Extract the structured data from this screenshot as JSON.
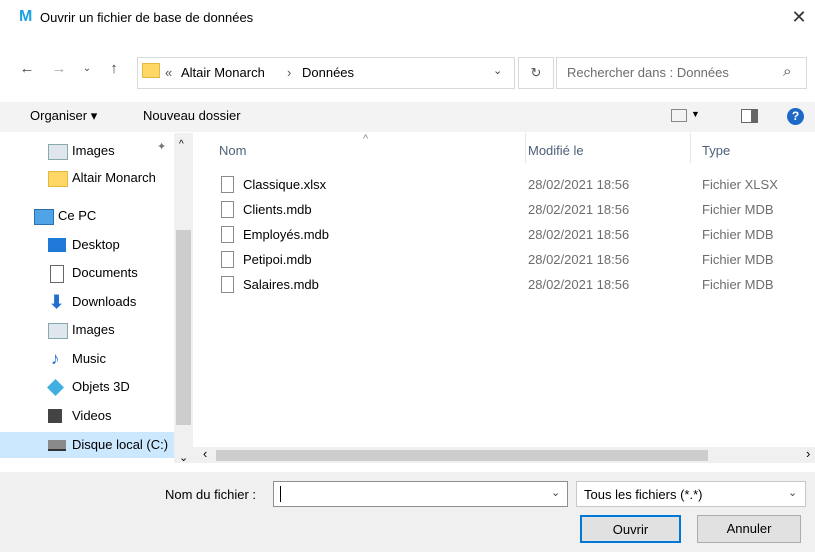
{
  "window": {
    "title": "Ouvrir un fichier de base de données",
    "app_icon": "M",
    "close": "✕"
  },
  "address": {
    "root_sep": "«",
    "crumbs": [
      "Altair Monarch",
      "Données"
    ],
    "sep": "›",
    "refresh": "↻"
  },
  "search": {
    "placeholder": "Rechercher dans : Données",
    "icon": "⌕"
  },
  "toolbar": {
    "organize": "Organiser ▾",
    "new_folder": "Nouveau dossier",
    "help": "?"
  },
  "sidebar": {
    "items": [
      {
        "label": "Images",
        "icon": "images-icon",
        "pinned": true
      },
      {
        "label": "Altair Monarch",
        "icon": "folder-icon"
      },
      {
        "label": "Ce PC",
        "icon": "computer-icon"
      },
      {
        "label": "Desktop",
        "icon": "desktop-icon"
      },
      {
        "label": "Documents",
        "icon": "documents-icon"
      },
      {
        "label": "Downloads",
        "icon": "downloads-icon"
      },
      {
        "label": "Images",
        "icon": "images-icon"
      },
      {
        "label": "Music",
        "icon": "music-icon"
      },
      {
        "label": "Objets 3D",
        "icon": "objects3d-icon"
      },
      {
        "label": "Videos",
        "icon": "videos-icon"
      },
      {
        "label": "Disque local (C:)",
        "icon": "drive-icon",
        "selected": true
      }
    ]
  },
  "columns": {
    "name": "Nom",
    "modified": "Modifié le",
    "type": "Type"
  },
  "files": [
    {
      "name": "Classique.xlsx",
      "modified": "28/02/2021 18:56",
      "type": "Fichier XLSX"
    },
    {
      "name": "Clients.mdb",
      "modified": "28/02/2021 18:56",
      "type": "Fichier MDB"
    },
    {
      "name": "Employés.mdb",
      "modified": "28/02/2021 18:56",
      "type": "Fichier MDB"
    },
    {
      "name": "Petipoi.mdb",
      "modified": "28/02/2021 18:56",
      "type": "Fichier MDB"
    },
    {
      "name": "Salaires.mdb",
      "modified": "28/02/2021 18:56",
      "type": "Fichier MDB"
    }
  ],
  "footer": {
    "filename_label": "Nom du fichier :",
    "filename_value": "",
    "filter_value": "Tous les fichiers (*.*)",
    "open": "Ouvrir",
    "cancel": "Annuler"
  },
  "colors": {
    "accent": "#0078d7",
    "selected_bg": "#cce8ff",
    "help": "#1e69c8"
  }
}
